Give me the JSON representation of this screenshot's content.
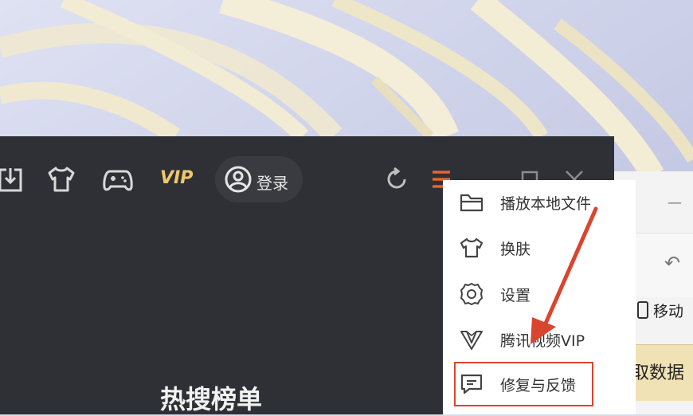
{
  "toolbar": {
    "vip_label": "VIP",
    "login_label": "登录",
    "icons": [
      "download-icon",
      "skin-shirt-icon",
      "gamepad-icon",
      "user-icon",
      "refresh-icon",
      "menu-icon",
      "window-restore-icon",
      "close-icon"
    ]
  },
  "menu": {
    "items": [
      {
        "label": "播放本地文件",
        "icon": "folder-icon"
      },
      {
        "label": "换肤",
        "icon": "shirt-icon"
      },
      {
        "label": "设置",
        "icon": "gear-icon"
      },
      {
        "label": "腾讯视频VIP",
        "icon": "vip-crown-icon"
      },
      {
        "label": "修复与反馈",
        "icon": "feedback-icon"
      }
    ],
    "highlighted_item": "修复与反馈"
  },
  "main": {
    "section_title": "热搜榜单"
  },
  "background_window": {
    "mobile_label": "移动",
    "fetch_label": "取数据"
  },
  "colors": {
    "player_bg": "#2f3035",
    "accent_orange": "#e8632b",
    "vip_gold": "#f0c76a",
    "annotation_red": "#d9452e"
  }
}
